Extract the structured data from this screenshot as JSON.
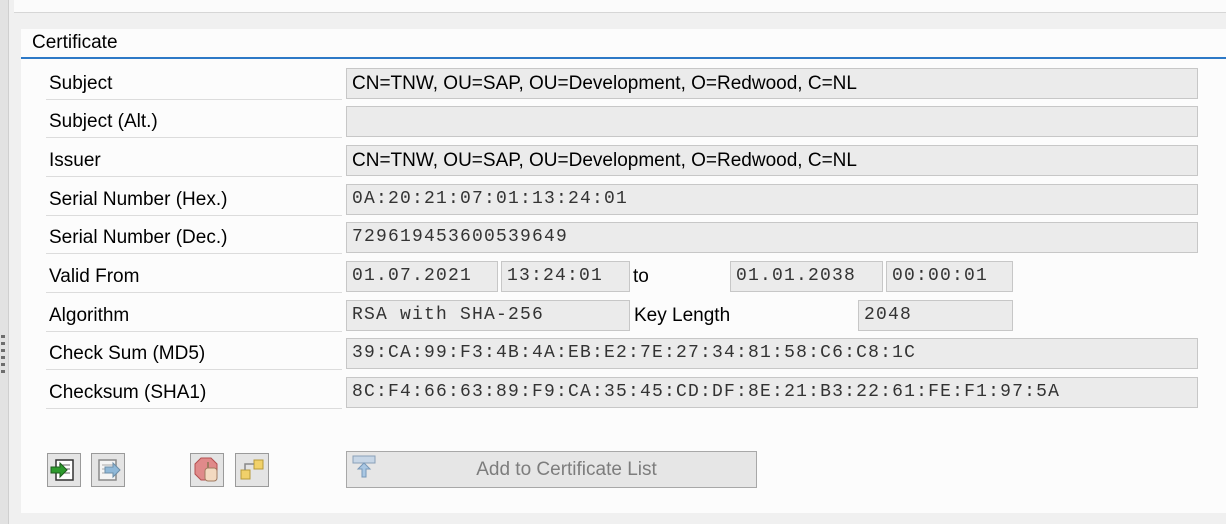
{
  "section_title": "Certificate",
  "fields": {
    "subject": {
      "label": "Subject",
      "value": "CN=TNW, OU=SAP, OU=Development, O=Redwood, C=NL"
    },
    "subject_alt": {
      "label": "Subject (Alt.)",
      "value": ""
    },
    "issuer": {
      "label": "Issuer",
      "value": "CN=TNW, OU=SAP, OU=Development, O=Redwood, C=NL"
    },
    "serial_hex": {
      "label": "Serial Number (Hex.)",
      "value": "0A:20:21:07:01:13:24:01"
    },
    "serial_dec": {
      "label": "Serial Number (Dec.)",
      "value": "729619453600539649"
    },
    "valid": {
      "label": "Valid From",
      "from_date": "01.07.2021",
      "from_time": "13:24:01",
      "to_label": "to",
      "to_date": "01.01.2038",
      "to_time": "00:00:01"
    },
    "algorithm": {
      "label": "Algorithm",
      "value": "RSA with SHA-256",
      "key_length_label": "Key Length",
      "key_length": "2048"
    },
    "md5": {
      "label": "Check Sum (MD5)",
      "value": "39:CA:99:F3:4B:4A:EB:E2:7E:27:34:81:58:C6:C8:1C"
    },
    "sha1": {
      "label": "Checksum (SHA1)",
      "value": "8C:F4:66:63:89:F9:CA:35:45:CD:DF:8E:21:B3:22:61:FE:F1:97:5A"
    }
  },
  "buttons": {
    "add_to_list_label": "Add to Certificate List",
    "icons": [
      "import-certificate-icon",
      "export-certificate-icon",
      "stop-hand-icon",
      "hierarchy-icon",
      "add-to-list-icon"
    ]
  },
  "colors": {
    "accent_line": "#2d79c7",
    "field_bg": "#ebebeb"
  }
}
